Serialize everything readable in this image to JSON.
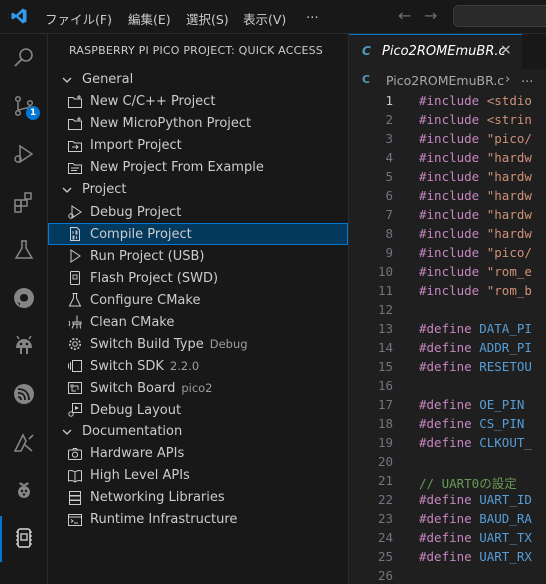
{
  "titlebar": {
    "menus": [
      "ファイル(F)",
      "編集(E)",
      "選択(S)",
      "表示(V)",
      "⋯"
    ]
  },
  "activity_bar": {
    "icons": [
      "explorer-search-icon",
      "source-control-icon",
      "run-debug-icon",
      "extensions-icon",
      "testing-icon",
      "github-icon",
      "android-icon",
      "espressif-icon",
      "arduino-icon",
      "raspberry-icon",
      "pico-icon"
    ],
    "badge": "1"
  },
  "sidebar": {
    "title": "RASPBERRY PI PICO PROJECT: QUICK ACCESS",
    "sections": {
      "general": "General",
      "project": "Project",
      "documentation": "Documentation"
    },
    "general_items": [
      {
        "label": "New C/C++ Project"
      },
      {
        "label": "New MicroPython Project"
      },
      {
        "label": "Import Project"
      },
      {
        "label": "New Project From Example"
      }
    ],
    "project_items": [
      {
        "label": "Debug Project",
        "desc": ""
      },
      {
        "label": "Compile Project",
        "desc": ""
      },
      {
        "label": "Run Project (USB)",
        "desc": ""
      },
      {
        "label": "Flash Project (SWD)",
        "desc": ""
      },
      {
        "label": "Configure CMake",
        "desc": ""
      },
      {
        "label": "Clean CMake",
        "desc": ""
      },
      {
        "label": "Switch Build Type",
        "desc": "Debug"
      },
      {
        "label": "Switch SDK",
        "desc": "2.2.0"
      },
      {
        "label": "Switch Board",
        "desc": "pico2"
      },
      {
        "label": "Debug Layout",
        "desc": ""
      }
    ],
    "doc_items": [
      {
        "label": "Hardware APIs"
      },
      {
        "label": "High Level APIs"
      },
      {
        "label": "Networking Libraries"
      },
      {
        "label": "Runtime Infrastructure"
      }
    ]
  },
  "editor": {
    "tab": {
      "icon": "C",
      "label": "Pico2ROMEmuBR.c",
      "close": "×"
    },
    "breadcrumb": {
      "icon": "C",
      "label": "Pico2ROMEmuBR.c",
      "sep": "›",
      "more": "..."
    },
    "lines": [
      {
        "n": "1",
        "kw": "#include",
        "rest": " <stdio",
        "cls": "str"
      },
      {
        "n": "2",
        "kw": "#include",
        "rest": " <strin",
        "cls": "str"
      },
      {
        "n": "3",
        "kw": "#include",
        "rest": " \"pico/",
        "cls": "str"
      },
      {
        "n": "4",
        "kw": "#include",
        "rest": " \"hardw",
        "cls": "str"
      },
      {
        "n": "5",
        "kw": "#include",
        "rest": " \"hardw",
        "cls": "str"
      },
      {
        "n": "6",
        "kw": "#include",
        "rest": " \"hardw",
        "cls": "str"
      },
      {
        "n": "7",
        "kw": "#include",
        "rest": " \"hardw",
        "cls": "str"
      },
      {
        "n": "8",
        "kw": "#include",
        "rest": " \"hardw",
        "cls": "str"
      },
      {
        "n": "9",
        "kw": "#include",
        "rest": " \"pico/",
        "cls": "str"
      },
      {
        "n": "10",
        "kw": "#include",
        "rest": " \"rom_e",
        "cls": "str"
      },
      {
        "n": "11",
        "kw": "#include",
        "rest": " \"rom_b",
        "cls": "str"
      },
      {
        "n": "12",
        "kw": "",
        "rest": "",
        "cls": "plain"
      },
      {
        "n": "13",
        "kw": "#define",
        "rest": " DATA_PI",
        "cls": "mac"
      },
      {
        "n": "14",
        "kw": "#define",
        "rest": " ADDR_PI",
        "cls": "mac"
      },
      {
        "n": "15",
        "kw": "#define",
        "rest": " RESETOU",
        "cls": "mac"
      },
      {
        "n": "16",
        "kw": "",
        "rest": "",
        "cls": "plain"
      },
      {
        "n": "17",
        "kw": "#define",
        "rest": " OE_PIN",
        "cls": "mac"
      },
      {
        "n": "18",
        "kw": "#define",
        "rest": " CS_PIN",
        "cls": "mac"
      },
      {
        "n": "19",
        "kw": "#define",
        "rest": " CLKOUT_",
        "cls": "mac"
      },
      {
        "n": "20",
        "kw": "",
        "rest": "",
        "cls": "plain"
      },
      {
        "n": "21",
        "kw": "",
        "rest": "// UART0の設定",
        "cls": "cmt"
      },
      {
        "n": "22",
        "kw": "#define",
        "rest": " UART_ID",
        "cls": "mac"
      },
      {
        "n": "23",
        "kw": "#define",
        "rest": " BAUD_RA",
        "cls": "mac"
      },
      {
        "n": "24",
        "kw": "#define",
        "rest": " UART_TX",
        "cls": "mac"
      },
      {
        "n": "25",
        "kw": "#define",
        "rest": " UART_RX",
        "cls": "mac"
      },
      {
        "n": "26",
        "kw": "",
        "rest": "",
        "cls": "plain"
      }
    ]
  },
  "colors": {
    "accent": "#0078d4",
    "selection": "#04395e",
    "background": "#1f1f1f",
    "sidebar": "#181818"
  }
}
